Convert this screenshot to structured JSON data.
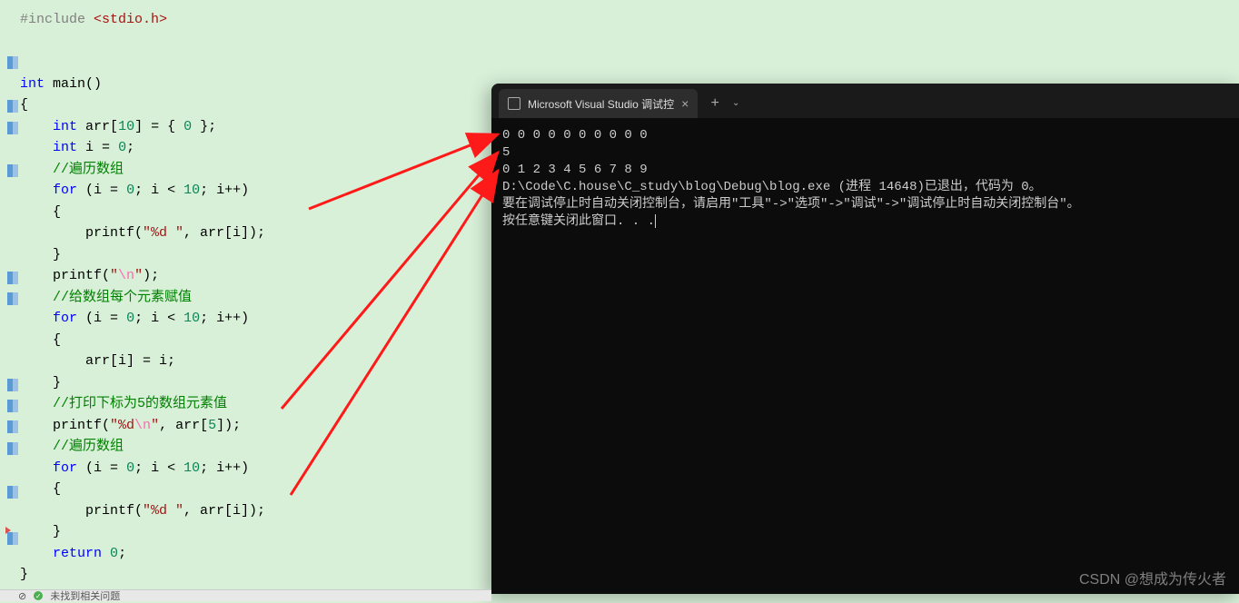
{
  "code": {
    "include": "#include",
    "header": "<stdio.h>",
    "kw_int": "int",
    "main": "main",
    "arr_decl": "arr",
    "ten": "10",
    "zero": "0",
    "i_var": "i",
    "cmt_traverse": "//遍历数组",
    "kw_for": "for",
    "printf": "printf",
    "fmt_d": "\"%d \"",
    "fmt_nl": "\"\\n\"",
    "cmt_assign": "//给数组每个元素赋值",
    "cmt_print5": "//打印下标为5的数组元素值",
    "fmt_dn": "\"%d\\n\"",
    "five": "5",
    "kw_return": "return"
  },
  "console": {
    "tab_title": "Microsoft Visual Studio 调试控",
    "line1": "0 0 0 0 0 0 0 0 0 0",
    "line2": "5",
    "line3": "0 1 2 3 4 5 6 7 8 9",
    "line4": "D:\\Code\\C.house\\C_study\\blog\\Debug\\blog.exe (进程 14648)已退出，代码为 0。",
    "line5": "要在调试停止时自动关闭控制台，请启用\"工具\"->\"选项\"->\"调试\"->\"调试停止时自动关闭控制台\"。",
    "line6": "按任意键关闭此窗口. . ."
  },
  "watermark": "CSDN @想成为传火者",
  "statusbar": "未找到相关问题",
  "chart_data": {
    "type": "table",
    "title": "Console output",
    "rows": [
      [
        "0",
        "0",
        "0",
        "0",
        "0",
        "0",
        "0",
        "0",
        "0",
        "0"
      ],
      [
        "5"
      ],
      [
        "0",
        "1",
        "2",
        "3",
        "4",
        "5",
        "6",
        "7",
        "8",
        "9"
      ]
    ]
  }
}
